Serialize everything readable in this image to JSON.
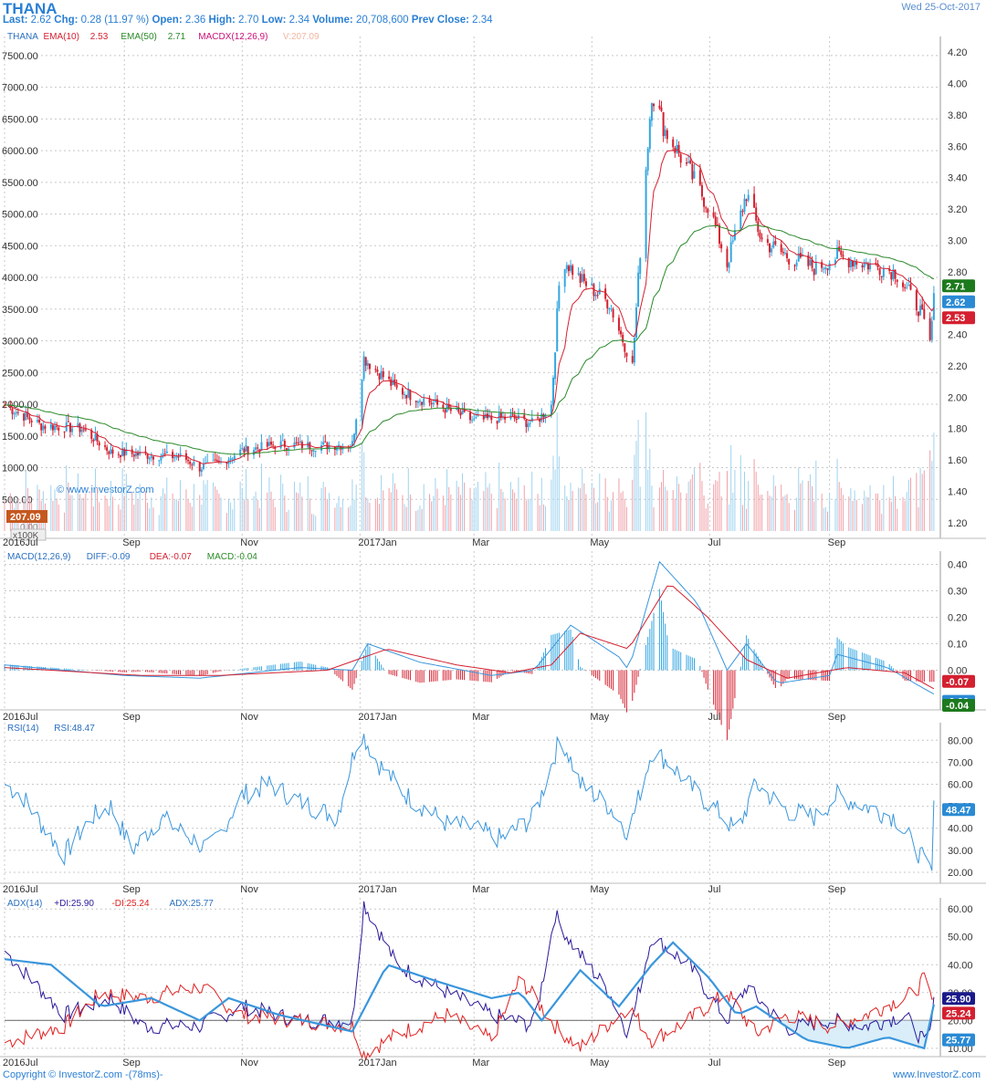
{
  "header": {
    "symbol": "THANA",
    "date": "Wed 25-Oct-2017",
    "quote_line": [
      {
        "label": "Last:",
        "value": "2.62"
      },
      {
        "label": "Chg:",
        "value": "0.28 (11.97 %)"
      },
      {
        "label": "Open:",
        "value": "2.36"
      },
      {
        "label": "High:",
        "value": "2.70"
      },
      {
        "label": "Low:",
        "value": "2.34"
      },
      {
        "label": "Volume:",
        "value": "20,708,600"
      },
      {
        "label": "Prev Close:",
        "value": "2.34"
      }
    ]
  },
  "colors": {
    "up": "#33a6e0",
    "down": "#d42030",
    "ema10": "#d42030",
    "ema50": "#2a8a2a",
    "macd_color": "#cc1177",
    "rsi": "#3a96dc",
    "plus_di": "#2a1a9a",
    "minus_di": "#e02020",
    "adx": "#3a96dc",
    "grid": "#c8c8c8",
    "axis_text": "#333333"
  },
  "legends": {
    "price": [
      {
        "text": "THANA",
        "color": "#2a6fc0"
      },
      {
        "text": "EMA(10)",
        "color": "#d42030"
      },
      {
        "text": "2.53",
        "color": "#d42030"
      },
      {
        "text": "EMA(50)",
        "color": "#2a8a2a"
      },
      {
        "text": "2.71",
        "color": "#2a8a2a"
      },
      {
        "text": "MACDX(12,26,9)",
        "color": "#cc1177"
      },
      {
        "text": "V:207.09",
        "color": "#f0b7a0"
      }
    ],
    "macd": [
      {
        "text": "MACD(12,26,9)",
        "color": "#2a6fc0"
      },
      {
        "text": "DIFF:-0.09",
        "color": "#2a6fc0"
      },
      {
        "text": "DEA:-0.07",
        "color": "#d42030"
      },
      {
        "text": "MACD:-0.04",
        "color": "#2a8a2a"
      }
    ],
    "rsi": [
      {
        "text": "RSI(14)",
        "color": "#2a6fc0"
      },
      {
        "text": "RSI:48.47",
        "color": "#2a6fc0"
      }
    ],
    "adx": [
      {
        "text": "ADX(14)",
        "color": "#2a6fc0"
      },
      {
        "text": "+DI:25.90",
        "color": "#2a1a9a"
      },
      {
        "text": "-DI:25.24",
        "color": "#e02020"
      },
      {
        "text": "ADX:25.77",
        "color": "#2a6fc0"
      }
    ]
  },
  "watermark": "© www.investorZ.com",
  "volume_badge": "207.09",
  "volume_zero": "0.00",
  "volume_unit": "x100K",
  "x_ticks": [
    "2016Jul",
    "Sep",
    "Nov",
    "2017Jan",
    "Mar",
    "May",
    "Jul",
    "Sep"
  ],
  "footer": {
    "left": "Copyright © InvestorZ.com  -(78ms)-",
    "right": "www.InvestorZ.com"
  },
  "chart_data": [
    {
      "type": "candlestick",
      "title": "THANA",
      "y_right_ticks": [
        "1.20",
        "1.40",
        "1.60",
        "1.80",
        "2.00",
        "2.20",
        "2.40",
        "2.60",
        "2.80",
        "3.00",
        "3.20",
        "3.40",
        "3.60",
        "3.80",
        "4.00",
        "4.20"
      ],
      "y_left_ticks": [
        "500.00",
        "1000.00",
        "1500.00",
        "2000.00",
        "2500.00",
        "3000.00",
        "3500.00",
        "4000.00",
        "4500.00",
        "5000.00",
        "5500.00",
        "6000.00",
        "6500.00",
        "7000.00",
        "7500.00"
      ],
      "ylim_price": [
        1.1,
        4.3
      ],
      "ylim_volume_left": [
        0,
        7800
      ],
      "close_keypoints": [
        [
          "2016-07-01",
          1.95
        ],
        [
          "2016-07-20",
          1.82
        ],
        [
          "2016-08-10",
          1.8
        ],
        [
          "2016-08-25",
          1.65
        ],
        [
          "2016-09-15",
          1.63
        ],
        [
          "2016-10-01",
          1.62
        ],
        [
          "2016-10-10",
          1.55
        ],
        [
          "2016-10-20",
          1.58
        ],
        [
          "2016-11-01",
          1.66
        ],
        [
          "2016-11-20",
          1.7
        ],
        [
          "2016-12-10",
          1.69
        ],
        [
          "2016-12-28",
          1.7
        ],
        [
          "2017-01-03",
          2.25
        ],
        [
          "2017-01-20",
          2.05
        ],
        [
          "2017-02-10",
          1.95
        ],
        [
          "2017-03-01",
          1.85
        ],
        [
          "2017-03-20",
          1.87
        ],
        [
          "2017-04-01",
          1.83
        ],
        [
          "2017-04-10",
          1.95
        ],
        [
          "2017-04-15",
          2.9
        ],
        [
          "2017-04-25",
          2.75
        ],
        [
          "2017-05-10",
          2.6
        ],
        [
          "2017-05-22",
          2.2
        ],
        [
          "2017-05-28",
          3.3
        ],
        [
          "2017-06-01",
          3.95
        ],
        [
          "2017-06-08",
          3.7
        ],
        [
          "2017-06-20",
          3.45
        ],
        [
          "2017-07-01",
          3.2
        ],
        [
          "2017-07-10",
          2.85
        ],
        [
          "2017-07-20",
          3.3
        ],
        [
          "2017-07-28",
          3.0
        ],
        [
          "2017-08-10",
          2.9
        ],
        [
          "2017-08-25",
          2.82
        ],
        [
          "2017-09-05",
          2.9
        ],
        [
          "2017-09-20",
          2.85
        ],
        [
          "2017-10-05",
          2.8
        ],
        [
          "2017-10-18",
          2.55
        ],
        [
          "2017-10-23",
          2.34
        ],
        [
          "2017-10-25",
          2.62
        ]
      ],
      "series": [
        {
          "name": "EMA(10)",
          "last": 2.53
        },
        {
          "name": "EMA(50)",
          "last": 2.71
        }
      ],
      "last_labels": {
        "price": "2.62",
        "ema10": "2.53",
        "ema50": "2.71"
      }
    },
    {
      "type": "line",
      "title": "MACD(12,26,9)",
      "y_ticks": [
        "0.00",
        "0.10",
        "0.20",
        "0.30",
        "0.40"
      ],
      "ylim": [
        -0.15,
        0.45
      ],
      "diff_keypoints": [
        [
          "2016-07-01",
          0.02
        ],
        [
          "2016-09-01",
          -0.02
        ],
        [
          "2016-10-10",
          -0.03
        ],
        [
          "2016-12-01",
          0.01
        ],
        [
          "2016-12-28",
          0.0
        ],
        [
          "2017-01-05",
          0.1
        ],
        [
          "2017-02-01",
          0.03
        ],
        [
          "2017-03-10",
          -0.02
        ],
        [
          "2017-04-01",
          0.0
        ],
        [
          "2017-04-20",
          0.17
        ],
        [
          "2017-05-15",
          0.05
        ],
        [
          "2017-05-20",
          0.0
        ],
        [
          "2017-06-05",
          0.41
        ],
        [
          "2017-06-25",
          0.25
        ],
        [
          "2017-07-10",
          0.0
        ],
        [
          "2017-07-20",
          0.1
        ],
        [
          "2017-08-05",
          -0.05
        ],
        [
          "2017-09-01",
          -0.02
        ],
        [
          "2017-09-05",
          0.06
        ],
        [
          "2017-10-01",
          0.01
        ],
        [
          "2017-10-20",
          -0.07
        ],
        [
          "2017-10-25",
          -0.09
        ]
      ],
      "dea_keypoints": [
        [
          "2016-07-01",
          0.01
        ],
        [
          "2016-09-10",
          -0.02
        ],
        [
          "2016-10-20",
          -0.02
        ],
        [
          "2016-12-15",
          0.0
        ],
        [
          "2017-01-15",
          0.08
        ],
        [
          "2017-02-20",
          0.02
        ],
        [
          "2017-03-20",
          -0.01
        ],
        [
          "2017-04-10",
          0.02
        ],
        [
          "2017-04-25",
          0.14
        ],
        [
          "2017-05-20",
          0.08
        ],
        [
          "2017-06-10",
          0.33
        ],
        [
          "2017-06-30",
          0.2
        ],
        [
          "2017-07-20",
          0.04
        ],
        [
          "2017-08-10",
          -0.03
        ],
        [
          "2017-09-10",
          0.01
        ],
        [
          "2017-10-10",
          -0.01
        ],
        [
          "2017-10-25",
          -0.07
        ]
      ],
      "last_labels": {
        "dea": "-0.07",
        "diff": "-0.09",
        "macd": "-0.04"
      }
    },
    {
      "type": "line",
      "title": "RSI(14)",
      "y_ticks": [
        "20.00",
        "30.00",
        "40.00",
        "50.00",
        "60.00",
        "70.00",
        "80.00"
      ],
      "ylim": [
        15,
        88
      ],
      "rsi_keypoints": [
        [
          "2016-07-01",
          60
        ],
        [
          "2016-07-10",
          55
        ],
        [
          "2016-07-20",
          42
        ],
        [
          "2016-08-01",
          28
        ],
        [
          "2016-08-15",
          45
        ],
        [
          "2016-08-25",
          50
        ],
        [
          "2016-09-05",
          30
        ],
        [
          "2016-09-20",
          45
        ],
        [
          "2016-10-01",
          38
        ],
        [
          "2016-10-15",
          30
        ],
        [
          "2016-11-01",
          55
        ],
        [
          "2016-11-15",
          60
        ],
        [
          "2016-12-01",
          52
        ],
        [
          "2016-12-20",
          45
        ],
        [
          "2017-01-01",
          85
        ],
        [
          "2017-01-10",
          70
        ],
        [
          "2017-01-25",
          55
        ],
        [
          "2017-02-15",
          42
        ],
        [
          "2017-03-01",
          40
        ],
        [
          "2017-03-15",
          35
        ],
        [
          "2017-04-01",
          45
        ],
        [
          "2017-04-15",
          82
        ],
        [
          "2017-04-25",
          60
        ],
        [
          "2017-05-10",
          50
        ],
        [
          "2017-05-20",
          38
        ],
        [
          "2017-06-01",
          75
        ],
        [
          "2017-06-10",
          70
        ],
        [
          "2017-06-25",
          55
        ],
        [
          "2017-07-05",
          48
        ],
        [
          "2017-07-15",
          38
        ],
        [
          "2017-07-25",
          60
        ],
        [
          "2017-08-10",
          48
        ],
        [
          "2017-08-25",
          45
        ],
        [
          "2017-09-05",
          55
        ],
        [
          "2017-09-20",
          50
        ],
        [
          "2017-10-05",
          45
        ],
        [
          "2017-10-20",
          25
        ],
        [
          "2017-10-24",
          20
        ],
        [
          "2017-10-25",
          48.47
        ]
      ],
      "last_labels": {
        "rsi": "48.47"
      }
    },
    {
      "type": "line",
      "title": "ADX(14)",
      "y_ticks": [
        "10.00",
        "20.00",
        "30.00",
        "40.00",
        "50.00",
        "60.00"
      ],
      "ylim": [
        7,
        64
      ],
      "reference_line": 20,
      "series": [
        {
          "name": "+DI",
          "last": 25.9
        },
        {
          "name": "-DI",
          "last": 25.24
        },
        {
          "name": "ADX",
          "last": 25.77
        }
      ],
      "plus_di_keypoints": [
        [
          "2016-07-01",
          45
        ],
        [
          "2016-08-01",
          22
        ],
        [
          "2016-08-25",
          28
        ],
        [
          "2016-09-10",
          18
        ],
        [
          "2016-10-10",
          18
        ],
        [
          "2016-11-01",
          25
        ],
        [
          "2016-12-01",
          20
        ],
        [
          "2016-12-28",
          20
        ],
        [
          "2017-01-03",
          62
        ],
        [
          "2017-01-20",
          40
        ],
        [
          "2017-02-15",
          30
        ],
        [
          "2017-03-10",
          22
        ],
        [
          "2017-04-01",
          18
        ],
        [
          "2017-04-12",
          58
        ],
        [
          "2017-04-20",
          48
        ],
        [
          "2017-05-10",
          30
        ],
        [
          "2017-05-20",
          15
        ],
        [
          "2017-06-01",
          50
        ],
        [
          "2017-06-20",
          40
        ],
        [
          "2017-07-10",
          20
        ],
        [
          "2017-07-20",
          32
        ],
        [
          "2017-08-10",
          17
        ],
        [
          "2017-09-01",
          20
        ],
        [
          "2017-09-20",
          18
        ],
        [
          "2017-10-10",
          22
        ],
        [
          "2017-10-22",
          10
        ],
        [
          "2017-10-25",
          25.9
        ]
      ],
      "minus_di_keypoints": [
        [
          "2016-07-01",
          12
        ],
        [
          "2016-08-01",
          18
        ],
        [
          "2016-08-20",
          30
        ],
        [
          "2016-09-10",
          28
        ],
        [
          "2016-10-10",
          32
        ],
        [
          "2016-11-01",
          22
        ],
        [
          "2016-12-01",
          20
        ],
        [
          "2016-12-28",
          18
        ],
        [
          "2017-01-03",
          8
        ],
        [
          "2017-01-20",
          15
        ],
        [
          "2017-02-15",
          22
        ],
        [
          "2017-03-10",
          13
        ],
        [
          "2017-03-25",
          35
        ],
        [
          "2017-04-12",
          18
        ],
        [
          "2017-04-25",
          10
        ],
        [
          "2017-05-20",
          25
        ],
        [
          "2017-06-01",
          13
        ],
        [
          "2017-06-20",
          20
        ],
        [
          "2017-07-10",
          30
        ],
        [
          "2017-07-25",
          15
        ],
        [
          "2017-08-10",
          22
        ],
        [
          "2017-09-01",
          18
        ],
        [
          "2017-09-20",
          22
        ],
        [
          "2017-10-15",
          30
        ],
        [
          "2017-10-20",
          35
        ],
        [
          "2017-10-25",
          25.24
        ]
      ],
      "adx_keypoints": [
        [
          "2016-07-01",
          42
        ],
        [
          "2016-07-25",
          40
        ],
        [
          "2016-08-20",
          25
        ],
        [
          "2016-09-15",
          28
        ],
        [
          "2016-10-10",
          20
        ],
        [
          "2016-10-25",
          28
        ],
        [
          "2016-11-20",
          22
        ],
        [
          "2016-12-28",
          16
        ],
        [
          "2017-01-15",
          40
        ],
        [
          "2017-02-10",
          34
        ],
        [
          "2017-03-10",
          28
        ],
        [
          "2017-03-25",
          30
        ],
        [
          "2017-04-05",
          20
        ],
        [
          "2017-04-25",
          38
        ],
        [
          "2017-05-15",
          25
        ],
        [
          "2017-06-01",
          40
        ],
        [
          "2017-06-12",
          48
        ],
        [
          "2017-07-01",
          35
        ],
        [
          "2017-07-15",
          22
        ],
        [
          "2017-07-25",
          25
        ],
        [
          "2017-08-20",
          13
        ],
        [
          "2017-09-10",
          10
        ],
        [
          "2017-10-01",
          14
        ],
        [
          "2017-10-20",
          10
        ],
        [
          "2017-10-25",
          25.77
        ]
      ],
      "last_labels": {
        "plus_di": "25.90",
        "minus_di": "25.24",
        "adx": "25.77"
      }
    }
  ]
}
